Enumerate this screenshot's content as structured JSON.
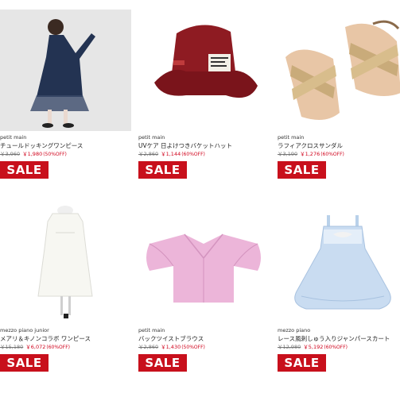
{
  "products": [
    {
      "brand": "petit main",
      "name": "チュールドッキングワンピース",
      "old_price": "￥3,960",
      "new_price": "￥1,980",
      "discount": "(50%OFF)",
      "badge": "SALE",
      "image": "girl-tulle-dress-photo"
    },
    {
      "brand": "petit main",
      "name": "UVケア 日よけつきバケットハット",
      "old_price": "￥2,860",
      "new_price": "￥1,144",
      "discount": "(60%OFF)",
      "badge": "SALE",
      "image": "red-bucket-hat-photo"
    },
    {
      "brand": "petit main",
      "name": "ラフィアクロスサンダル",
      "old_price": "￥3,190",
      "new_price": "￥1,276",
      "discount": "(60%OFF)",
      "badge": "SALE",
      "image": "raffia-sandals-photo"
    },
    {
      "brand": "mezzo piano junior",
      "name": "メアリ＆キノンコラボ ワンピース",
      "old_price": "￥15,180",
      "new_price": "￥6,072",
      "discount": "(60%OFF)",
      "badge": "SALE",
      "image": "white-dress-mannequin-photo"
    },
    {
      "brand": "petit main",
      "name": "バックツイストブラウス",
      "old_price": "￥2,860",
      "new_price": "￥1,430",
      "discount": "(50%OFF)",
      "badge": "SALE",
      "image": "pink-blouse-photo"
    },
    {
      "brand": "mezzo piano",
      "name": "レース風刺しゅう入りジャンパースカート",
      "old_price": "￥12,980",
      "new_price": "￥5,192",
      "discount": "(60%OFF)",
      "badge": "SALE",
      "image": "blue-jumper-skirt-photo"
    }
  ],
  "colors": {
    "sale_badge": "#c8101c",
    "sale_price": "#d0021b",
    "old_price": "#777777"
  }
}
